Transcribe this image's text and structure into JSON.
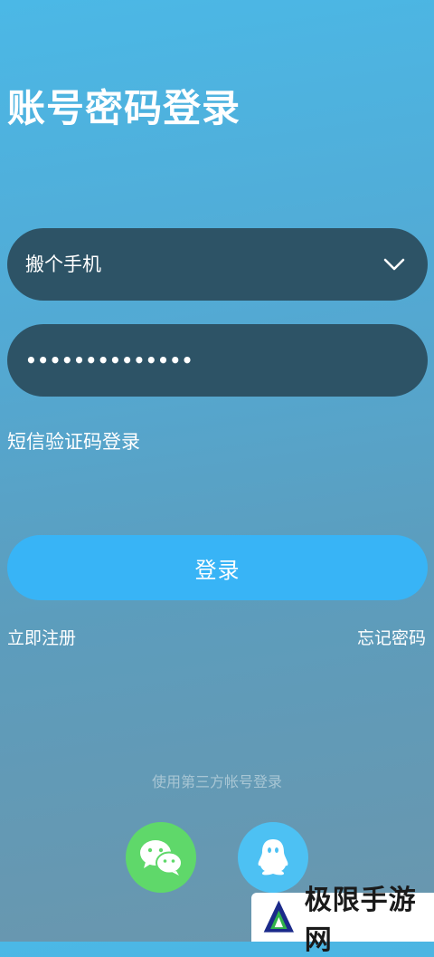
{
  "header": {
    "title": "账号密码登录"
  },
  "form": {
    "account_value": "搬个手机",
    "password_value": "••••••••••••••",
    "sms_login_label": "短信验证码登录",
    "login_button_label": "登录",
    "register_label": "立即注册",
    "forgot_label": "忘记密码"
  },
  "third_party": {
    "label": "使用第三方帐号登录",
    "providers": [
      "wechat-icon",
      "qq-icon"
    ]
  },
  "watermark": {
    "text": "极限手游网"
  },
  "colors": {
    "field_bg": "#2d5366",
    "button_bg": "#38b4f6",
    "wechat": "#5fd86a",
    "qq": "#4dc1f3"
  }
}
